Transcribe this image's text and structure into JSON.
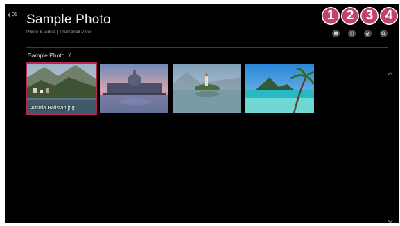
{
  "header": {
    "back_label": "01",
    "title": "Sample Photo",
    "subtitle_part1": "Photo & Video",
    "subtitle_sep": "|",
    "subtitle_part2": "Thumbnail View"
  },
  "toolbar": {
    "buttons": [
      {
        "icon": "play-slideshow-icon",
        "marker": "1"
      },
      {
        "icon": "view-type-icon",
        "marker": "2"
      },
      {
        "icon": "select-checkmark-icon",
        "marker": "3"
      },
      {
        "icon": "search-icon",
        "marker": "4"
      }
    ],
    "marker_color": "#c2436a"
  },
  "breadcrumb": {
    "folder": "Sample Photo",
    "separator": "/"
  },
  "photos": [
    {
      "caption": "Austria Hallstatt.jpg",
      "selected": true
    },
    {
      "caption": "",
      "selected": false
    },
    {
      "caption": "",
      "selected": false
    },
    {
      "caption": "",
      "selected": false
    }
  ],
  "colors": {
    "selection": "#b5284f",
    "background": "#000000"
  }
}
